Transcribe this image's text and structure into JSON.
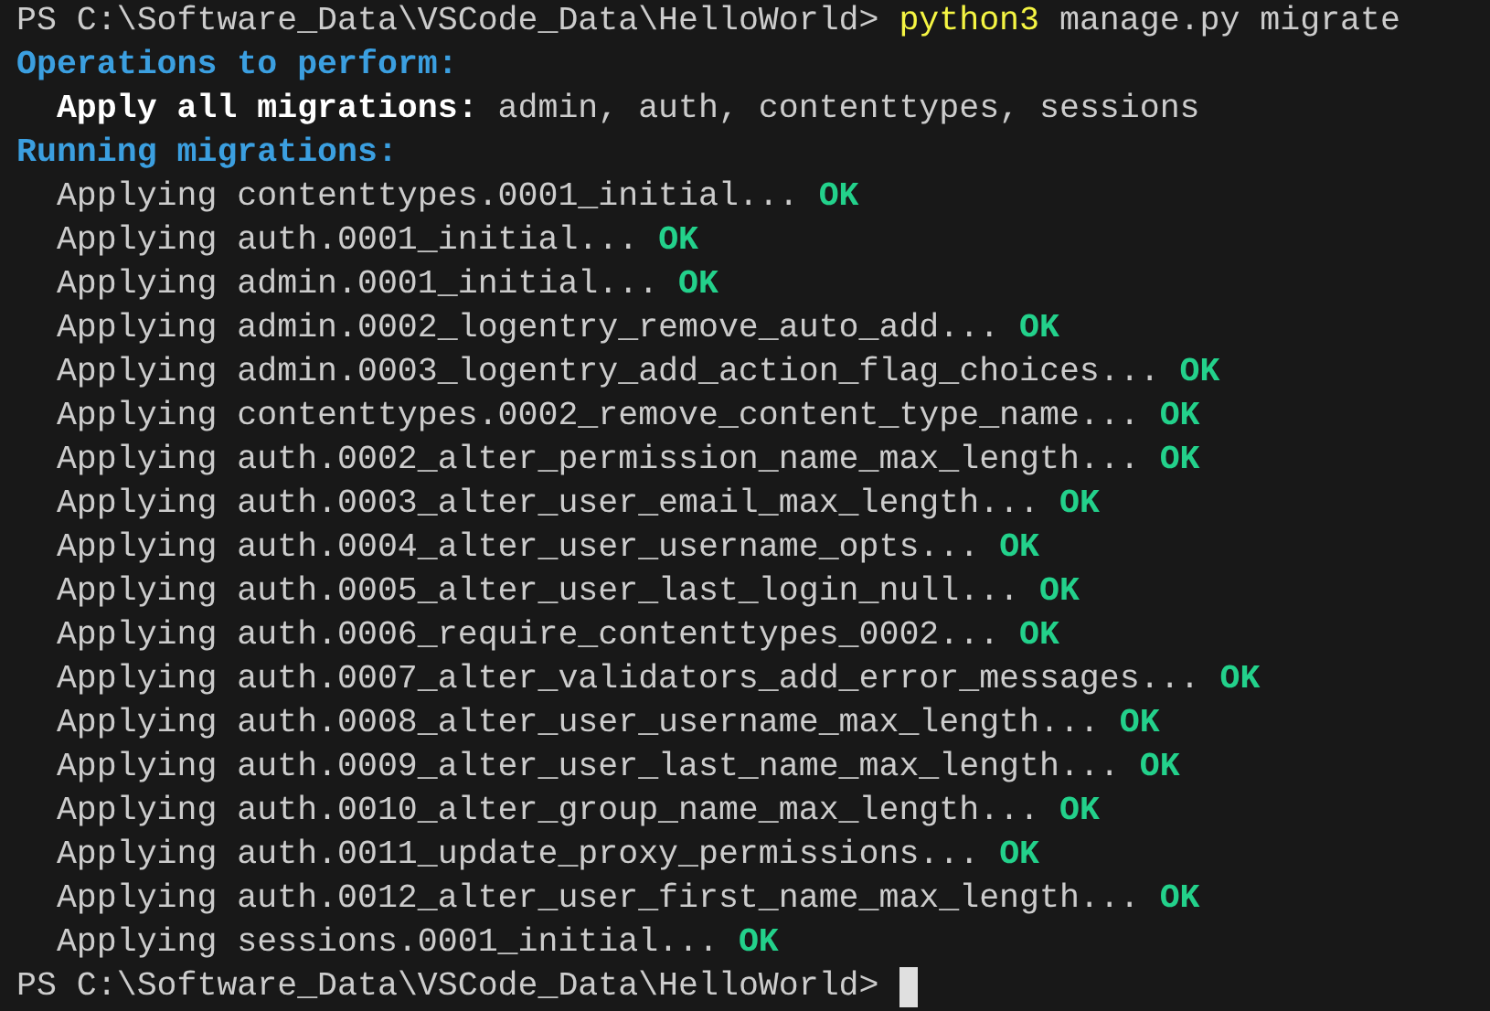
{
  "terminal": {
    "lines": [
      {
        "kind": "prompt",
        "prompt": "PS C:\\Software_Data\\VSCode_Data\\HelloWorld>",
        "program": "python3",
        "args": "manage.py migrate"
      },
      {
        "kind": "heading",
        "text": "Operations to perform:"
      },
      {
        "kind": "apply_all",
        "label": "Apply all migrations:",
        "value": "admin, auth, contenttypes, sessions"
      },
      {
        "kind": "heading",
        "text": "Running migrations:"
      },
      {
        "kind": "migration",
        "text": "Applying contenttypes.0001_initial...",
        "status": "OK"
      },
      {
        "kind": "migration",
        "text": "Applying auth.0001_initial...",
        "status": "OK"
      },
      {
        "kind": "migration",
        "text": "Applying admin.0001_initial...",
        "status": "OK"
      },
      {
        "kind": "migration",
        "text": "Applying admin.0002_logentry_remove_auto_add...",
        "status": "OK"
      },
      {
        "kind": "migration",
        "text": "Applying admin.0003_logentry_add_action_flag_choices...",
        "status": "OK"
      },
      {
        "kind": "migration",
        "text": "Applying contenttypes.0002_remove_content_type_name...",
        "status": "OK"
      },
      {
        "kind": "migration",
        "text": "Applying auth.0002_alter_permission_name_max_length...",
        "status": "OK"
      },
      {
        "kind": "migration",
        "text": "Applying auth.0003_alter_user_email_max_length...",
        "status": "OK"
      },
      {
        "kind": "migration",
        "text": "Applying auth.0004_alter_user_username_opts...",
        "status": "OK"
      },
      {
        "kind": "migration",
        "text": "Applying auth.0005_alter_user_last_login_null...",
        "status": "OK"
      },
      {
        "kind": "migration",
        "text": "Applying auth.0006_require_contenttypes_0002...",
        "status": "OK"
      },
      {
        "kind": "migration",
        "text": "Applying auth.0007_alter_validators_add_error_messages...",
        "status": "OK"
      },
      {
        "kind": "migration",
        "text": "Applying auth.0008_alter_user_username_max_length...",
        "status": "OK"
      },
      {
        "kind": "migration",
        "text": "Applying auth.0009_alter_user_last_name_max_length...",
        "status": "OK"
      },
      {
        "kind": "migration",
        "text": "Applying auth.0010_alter_group_name_max_length...",
        "status": "OK"
      },
      {
        "kind": "migration",
        "text": "Applying auth.0011_update_proxy_permissions...",
        "status": "OK"
      },
      {
        "kind": "migration",
        "text": "Applying auth.0012_alter_user_first_name_max_length...",
        "status": "OK"
      },
      {
        "kind": "migration",
        "text": "Applying sessions.0001_initial...",
        "status": "OK"
      },
      {
        "kind": "prompt",
        "prompt": "PS C:\\Software_Data\\VSCode_Data\\HelloWorld>",
        "cursor": true
      }
    ]
  }
}
